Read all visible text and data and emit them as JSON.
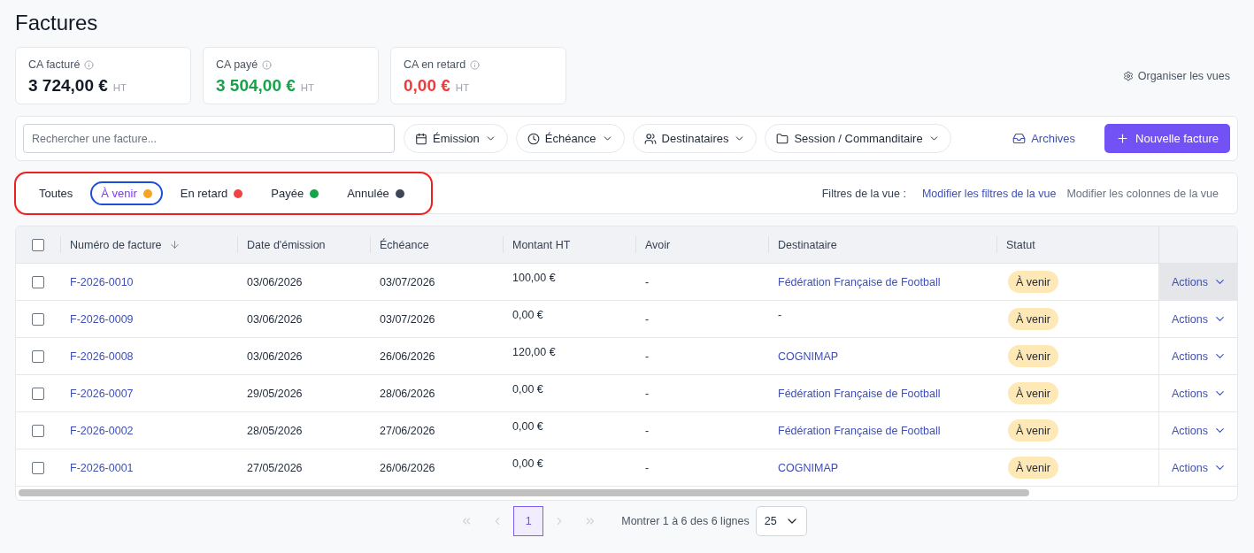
{
  "page": {
    "title": "Factures",
    "organize_views": "Organiser les vues"
  },
  "kpis": [
    {
      "label": "CA facturé",
      "value": "3 724,00 €",
      "unit": "HT",
      "color": "#111827"
    },
    {
      "label": "CA payé",
      "value": "3 504,00 €",
      "unit": "HT",
      "color": "#16a34a"
    },
    {
      "label": "CA en retard",
      "value": "0,00 €",
      "unit": "HT",
      "color": "#ef3b3b"
    }
  ],
  "toolbar": {
    "search": {
      "placeholder": "Rechercher une facture..."
    },
    "filters": [
      {
        "label": "Émission"
      },
      {
        "label": "Échéance"
      },
      {
        "label": "Destinataires"
      },
      {
        "label": "Session / Commanditaire"
      }
    ],
    "archives": "Archives",
    "new_button": "Nouvelle facture"
  },
  "status_filter": {
    "highlighted": true,
    "tabs": [
      {
        "label": "Toutes",
        "selected": false
      },
      {
        "label": "À venir",
        "selected": true,
        "color": "#f5a524"
      },
      {
        "label": "En retard",
        "selected": false,
        "color": "#ef4444"
      },
      {
        "label": "Payée",
        "selected": false,
        "color": "#16a34a"
      },
      {
        "label": "Annulée",
        "selected": false,
        "color": "#3f4658"
      }
    ],
    "view_label": "Filtres de la vue :",
    "view_links": [
      {
        "label": "Modifier les filtres de la vue",
        "kind": "primary"
      },
      {
        "label": "Modifier les colonnes de la vue",
        "kind": "secondary"
      }
    ]
  },
  "table": {
    "select_all": {
      "checked": false
    },
    "columns": [
      {
        "label": "Numéro de facture",
        "sorted": true
      },
      {
        "label": "Date d'émission",
        "sorted": false
      },
      {
        "label": "Échéance",
        "sorted": false
      },
      {
        "label": "Montant HT",
        "sorted": false
      },
      {
        "label": "Avoir",
        "sorted": false
      },
      {
        "label": "Destinataire",
        "sorted": false
      },
      {
        "label": "Statut",
        "sorted": false
      }
    ],
    "rows": [
      {
        "checked": false,
        "hovered": true,
        "number": "F-2026-0010",
        "issued": "03/06/2026",
        "due": "03/07/2026",
        "amount": "100,00 €",
        "credit": "-",
        "recipient": "Fédération Française de Football",
        "recipient_linked": true,
        "status": {
          "label": "À venir",
          "color": "#fde8b6"
        },
        "action": "Actions"
      },
      {
        "checked": false,
        "hovered": false,
        "number": "F-2026-0009",
        "issued": "03/06/2026",
        "due": "03/07/2026",
        "amount": "0,00 €",
        "credit": "-",
        "recipient": "-",
        "recipient_linked": false,
        "status": {
          "label": "À venir",
          "color": "#fde8b6"
        },
        "action": "Actions"
      },
      {
        "checked": false,
        "hovered": false,
        "number": "F-2026-0008",
        "issued": "03/06/2026",
        "due": "26/06/2026",
        "amount": "120,00 €",
        "credit": "-",
        "recipient": "COGNIMAP",
        "recipient_linked": true,
        "status": {
          "label": "À venir",
          "color": "#fde8b6"
        },
        "action": "Actions"
      },
      {
        "checked": false,
        "hovered": false,
        "number": "F-2026-0007",
        "issued": "29/05/2026",
        "due": "28/06/2026",
        "amount": "0,00 €",
        "credit": "-",
        "recipient": "Fédération Française de Football",
        "recipient_linked": true,
        "status": {
          "label": "À venir",
          "color": "#fde8b6"
        },
        "action": "Actions"
      },
      {
        "checked": false,
        "hovered": false,
        "number": "F-2026-0002",
        "issued": "28/05/2026",
        "due": "27/06/2026",
        "amount": "0,00 €",
        "credit": "-",
        "recipient": "Fédération Française de Football",
        "recipient_linked": true,
        "status": {
          "label": "À venir",
          "color": "#fde8b6"
        },
        "action": "Actions"
      },
      {
        "checked": false,
        "hovered": false,
        "number": "F-2026-0001",
        "issued": "27/05/2026",
        "due": "26/06/2026",
        "amount": "0,00 €",
        "credit": "-",
        "recipient": "COGNIMAP",
        "recipient_linked": true,
        "status": {
          "label": "À venir",
          "color": "#fde8b6"
        },
        "action": "Actions"
      }
    ]
  },
  "pagination": {
    "back": [
      {
        "kind": "first",
        "disabled": true
      },
      {
        "kind": "previous",
        "disabled": true
      }
    ],
    "pages": [
      {
        "label": "1",
        "selected": true
      }
    ],
    "forward": [
      {
        "kind": "next",
        "disabled": true
      },
      {
        "kind": "last",
        "disabled": true
      }
    ],
    "summary": "Montrer 1 à 6 des 6 lignes",
    "page_size": "25"
  }
}
